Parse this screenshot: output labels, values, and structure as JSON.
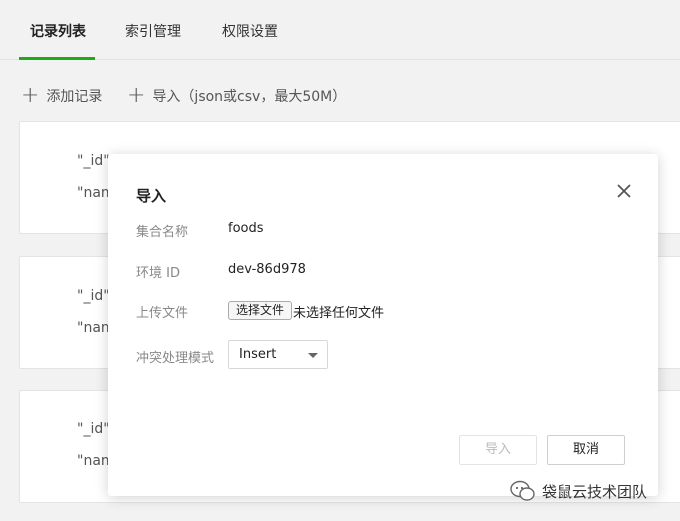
{
  "tabs": [
    {
      "label": "记录列表",
      "active": true
    },
    {
      "label": "索引管理",
      "active": false
    },
    {
      "label": "权限设置",
      "active": false
    }
  ],
  "toolbar": {
    "add_record": "添加记录",
    "import": "导入（json或csv，最大50M）"
  },
  "records": [
    {
      "id_line": "\"_id\":",
      "name_line": "\"nam"
    },
    {
      "id_line": "\"_id\":",
      "name_line": "\"nam"
    },
    {
      "id_line": "\"_id\":",
      "name_line": "\"nam"
    }
  ],
  "modal": {
    "title": "导入",
    "fields": {
      "collection_label": "集合名称",
      "collection_value": "foods",
      "env_label": "环境 ID",
      "env_value": "dev-86d978",
      "upload_label": "上传文件",
      "upload_button": "选择文件",
      "upload_status": "未选择任何文件",
      "conflict_label": "冲突处理模式",
      "conflict_value": "Insert"
    },
    "buttons": {
      "import": "导入",
      "cancel": "取消"
    }
  },
  "watermark": {
    "text": "袋鼠云技术团队"
  },
  "colors": {
    "accent": "#1aad19",
    "background": "#f2f2f2"
  }
}
